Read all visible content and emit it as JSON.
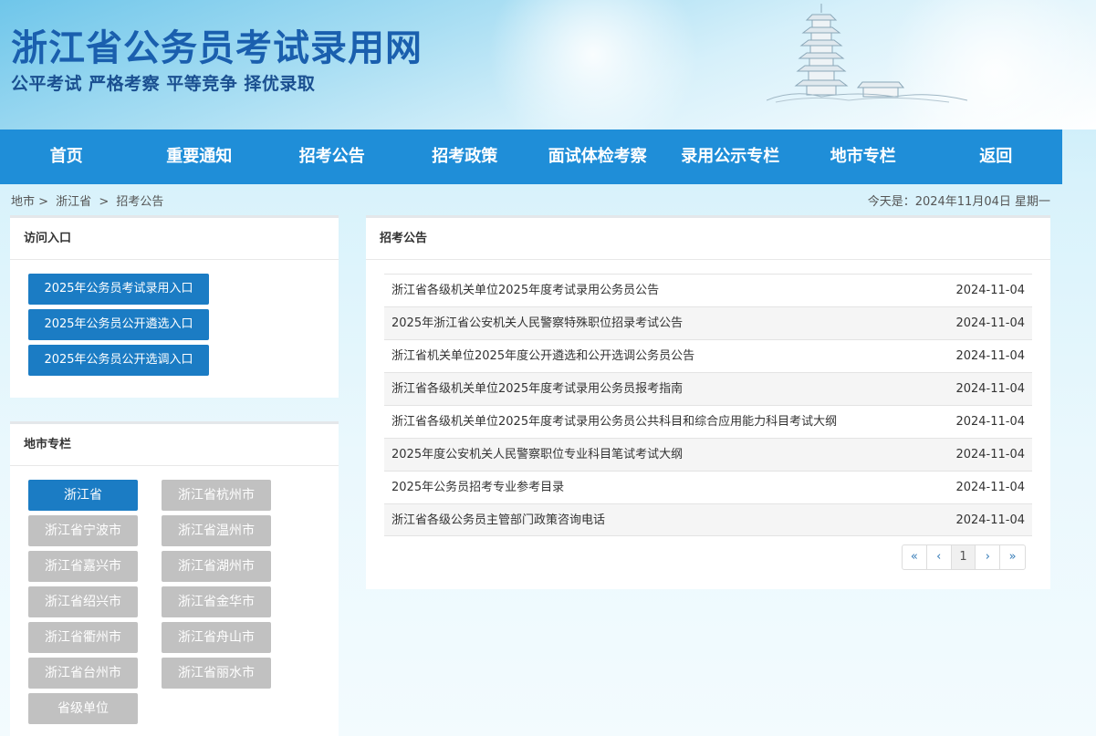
{
  "header": {
    "site_title": "浙江省公务员考试录用网",
    "slogan": "公平考试 严格考察 平等竞争 择优录取"
  },
  "nav": [
    "首页",
    "重要通知",
    "招考公告",
    "招考政策",
    "面试体检考察",
    "录用公示专栏",
    "地市专栏",
    "返回"
  ],
  "breadcrumb": [
    "地市 >",
    "浙江省",
    ">",
    "招考公告"
  ],
  "today": "今天是：2024年11月04日 星期一",
  "access_panel": {
    "title": "访问入口",
    "buttons": [
      "2025年公务员考试录用入口",
      "2025年公务员公开遴选入口",
      "2025年公务员公开选调入口"
    ]
  },
  "city_panel": {
    "title": "地市专栏",
    "cities": [
      "浙江省",
      "浙江省杭州市",
      "浙江省宁波市",
      "浙江省温州市",
      "浙江省嘉兴市",
      "浙江省湖州市",
      "浙江省绍兴市",
      "浙江省金华市",
      "浙江省衢州市",
      "浙江省舟山市",
      "浙江省台州市",
      "浙江省丽水市",
      "省级单位"
    ],
    "active": "浙江省"
  },
  "news_panel": {
    "title": "招考公告",
    "items": [
      {
        "title": "浙江省各级机关单位2025年度考试录用公务员公告",
        "date": "2024-11-04"
      },
      {
        "title": "2025年浙江省公安机关人民警察特殊职位招录考试公告",
        "date": "2024-11-04"
      },
      {
        "title": "浙江省机关单位2025年度公开遴选和公开选调公务员公告",
        "date": "2024-11-04"
      },
      {
        "title": "浙江省各级机关单位2025年度考试录用公务员报考指南",
        "date": "2024-11-04"
      },
      {
        "title": "浙江省各级机关单位2025年度考试录用公务员公共科目和综合应用能力科目考试大纲",
        "date": "2024-11-04"
      },
      {
        "title": "2025年度公安机关人民警察职位专业科目笔试考试大纲",
        "date": "2024-11-04"
      },
      {
        "title": "2025年公务员招考专业参考目录",
        "date": "2024-11-04"
      },
      {
        "title": "浙江省各级公务员主管部门政策咨询电话",
        "date": "2024-11-04"
      }
    ]
  },
  "pagination": [
    "«",
    "‹",
    "1",
    "›",
    "»"
  ],
  "colors": {
    "nav": "#1f8ed8",
    "button": "#1b7cc4",
    "city_inactive": "#c1c1c1",
    "title": "#1a5fae"
  }
}
